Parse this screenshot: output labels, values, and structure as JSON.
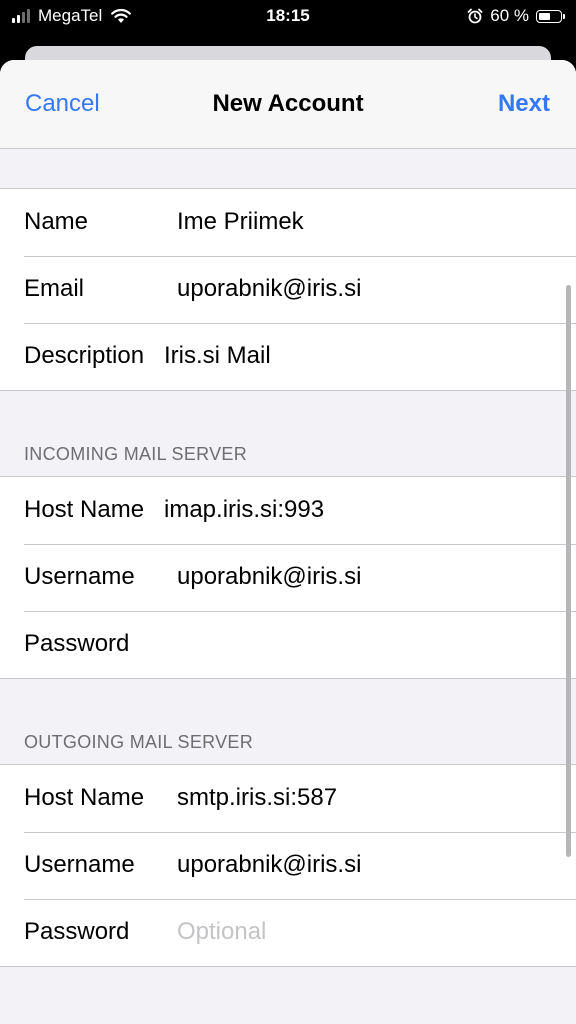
{
  "status_bar": {
    "carrier": "MegaTel",
    "time": "18:15",
    "battery": "60 %",
    "battery_level": 0.6
  },
  "nav": {
    "cancel": "Cancel",
    "title": "New Account",
    "next": "Next"
  },
  "account": {
    "name_label": "Name",
    "name_value": "Ime Priimek",
    "email_label": "Email",
    "email_value": "uporabnik@iris.si",
    "description_label": "Description",
    "description_value": "Iris.si Mail"
  },
  "incoming": {
    "header": "INCOMING MAIL SERVER",
    "host_label": "Host Name",
    "host_value": "imap.iris.si:993",
    "username_label": "Username",
    "username_value": "uporabnik@iris.si",
    "password_label": "Password",
    "password_value": ""
  },
  "outgoing": {
    "header": "OUTGOING MAIL SERVER",
    "host_label": "Host Name",
    "host_value": "smtp.iris.si:587",
    "username_label": "Username",
    "username_value": "uporabnik@iris.si",
    "password_label": "Password",
    "password_placeholder": "Optional"
  },
  "colors": {
    "accent": "#3478f6",
    "background": "#f2f2f7",
    "placeholder": "#c4c4c7"
  },
  "icons": [
    "signal-icon",
    "wifi-icon",
    "alarm-icon",
    "battery-icon"
  ]
}
